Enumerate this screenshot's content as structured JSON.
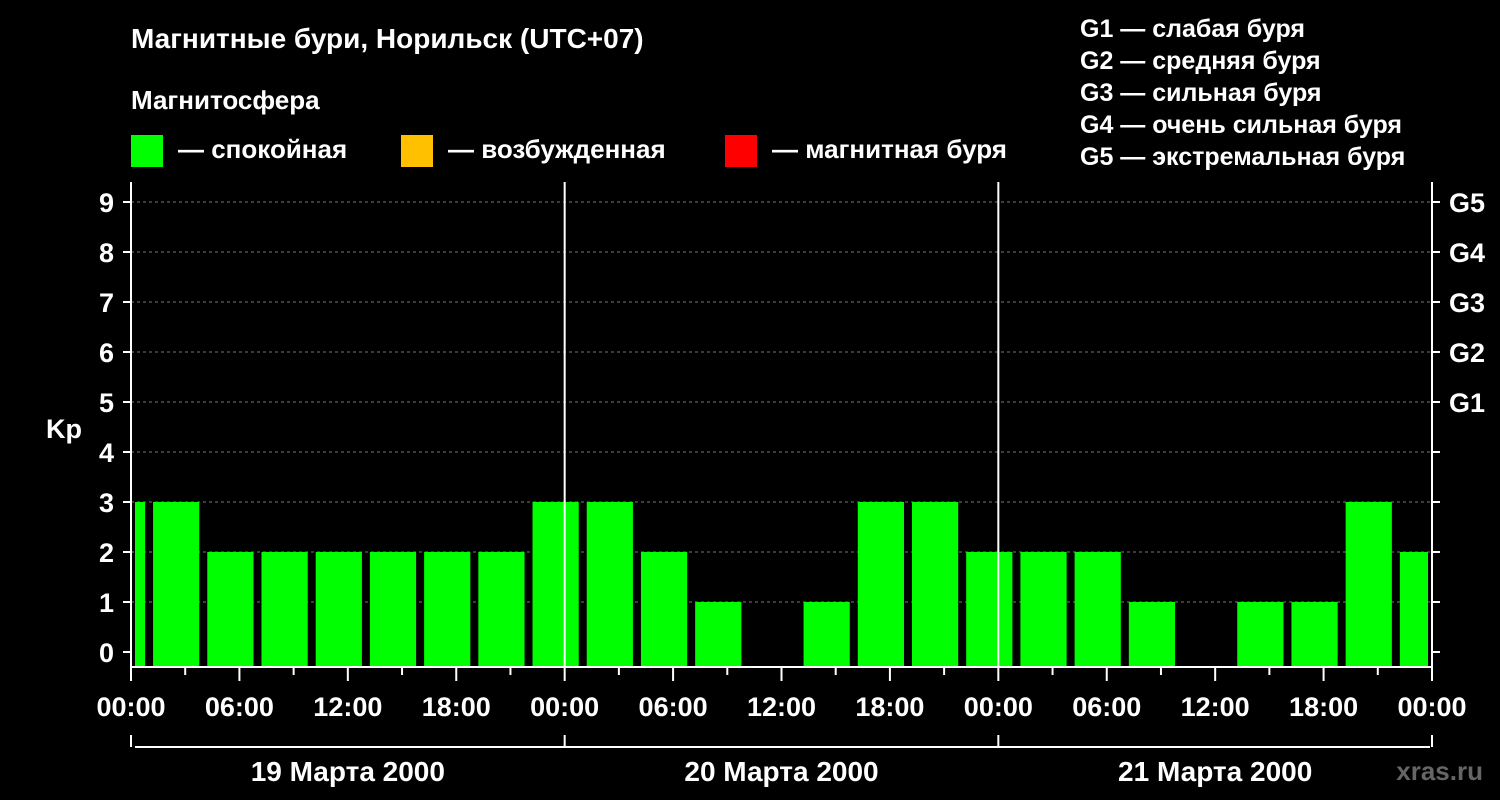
{
  "title": "Магнитные бури, Норильск (UTC+07)",
  "subtitle": "Магнитосфера",
  "legend": [
    {
      "label": "— спокойная",
      "color": "#00ff00"
    },
    {
      "label": "— возбужденная",
      "color": "#ffc000"
    },
    {
      "label": "— магнитная буря",
      "color": "#ff0000"
    }
  ],
  "g_scale": [
    "G1 — слабая буря",
    "G2 — средняя буря",
    "G3 — сильная буря",
    "G4 — очень сильная буря",
    "G5 — экстремальная буря"
  ],
  "watermark": "xras.ru",
  "chart_data": {
    "type": "bar",
    "ylabel": "Kp",
    "ylim": [
      0,
      9
    ],
    "yticks": [
      0,
      1,
      2,
      3,
      4,
      5,
      6,
      7,
      8,
      9
    ],
    "right_ticks": [
      {
        "value": 5,
        "label": "G1"
      },
      {
        "value": 6,
        "label": "G2"
      },
      {
        "value": 7,
        "label": "G3"
      },
      {
        "value": 8,
        "label": "G4"
      },
      {
        "value": 9,
        "label": "G5"
      }
    ],
    "xtick_labels": [
      "00:00",
      "06:00",
      "12:00",
      "18:00",
      "00:00",
      "06:00",
      "12:00",
      "18:00",
      "00:00",
      "06:00",
      "12:00",
      "18:00",
      "00:00"
    ],
    "days": [
      "19 Марта 2000",
      "20 Марта 2000",
      "21 Марта 2000"
    ],
    "bar_interval_hours": 3,
    "first_bar_start_hour": -2,
    "values": [
      3,
      3,
      2,
      2,
      2,
      2,
      2,
      2,
      3,
      3,
      2,
      1,
      0,
      1,
      3,
      3,
      2,
      2,
      2,
      1,
      0,
      1,
      1,
      3,
      2
    ],
    "color": "#00ff00",
    "grid": true
  }
}
